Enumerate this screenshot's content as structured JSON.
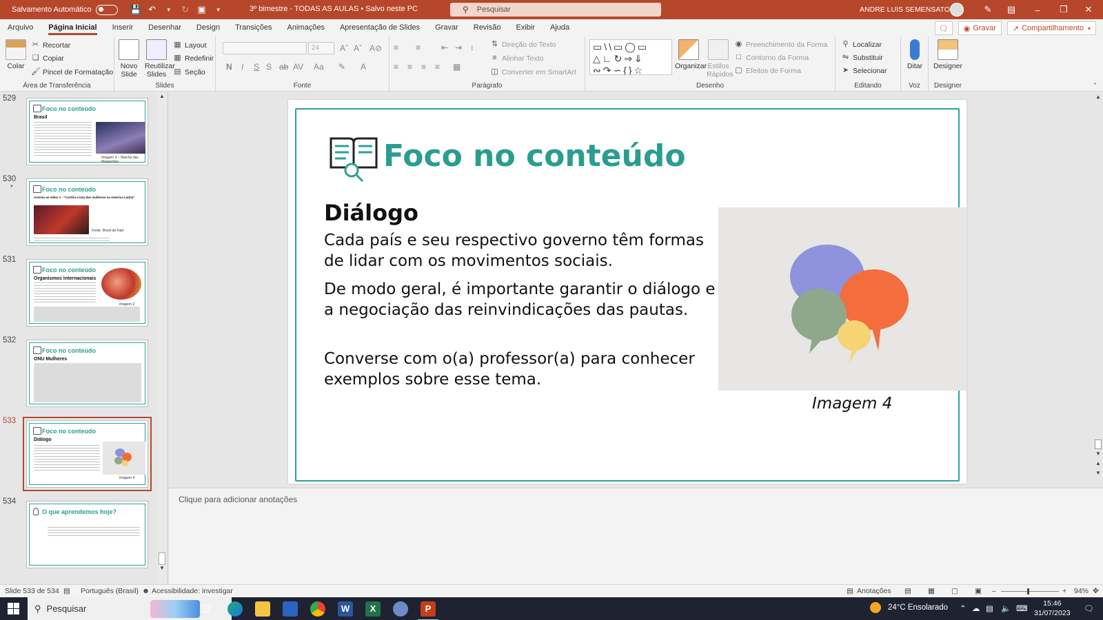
{
  "titlebar": {
    "autosave_label": "Salvamento Automático",
    "doc_title": "3º bimestre - TODAS AS AULAS • Salvo neste PC",
    "search_placeholder": "Pesquisar",
    "user_name": "ANDRE LUIS SEMENSATO",
    "accent": "#b7472a"
  },
  "menu": {
    "tabs": [
      "Arquivo",
      "Página Inicial",
      "Inserir",
      "Desenhar",
      "Design",
      "Transições",
      "Animações",
      "Apresentação de Slides",
      "Gravar",
      "Revisão",
      "Exibir",
      "Ajuda"
    ],
    "active_tab": "Página Inicial",
    "gravar_button": "Gravar",
    "share_button": "Compartilhamento"
  },
  "ribbon": {
    "clipboard": {
      "paste": "Colar",
      "cut": "Recortar",
      "copy": "Copiar",
      "format_painter": "Pincel de Formatação",
      "label": "Área de Transferência"
    },
    "slides": {
      "new_slide_1": "Novo",
      "new_slide_2": "Slide",
      "reuse_1": "Reutilizar",
      "reuse_2": "Slides",
      "layout": "Layout",
      "reset": "Redefinir",
      "section": "Seção",
      "label": "Slides"
    },
    "font": {
      "size": "24",
      "label": "Fonte"
    },
    "paragraph": {
      "text_direction": "Direção do Texto",
      "align_text": "Alinhar Texto",
      "smartart": "Converter em SmartArt",
      "label": "Parágrafo"
    },
    "drawing": {
      "arrange": "Organizar",
      "quick_styles_1": "Estilos",
      "quick_styles_2": "Rápidos",
      "shape_fill": "Preenchimento da Forma",
      "shape_outline": "Contorno da Forma",
      "shape_effects": "Efeitos de Forma",
      "label": "Desenho"
    },
    "editing": {
      "find": "Localizar",
      "replace": "Substituir",
      "select": "Selecionar",
      "label": "Editando"
    },
    "voice": {
      "dictate": "Ditar",
      "label": "Voz"
    },
    "designer": {
      "button": "Designer",
      "label": "Designer"
    }
  },
  "thumbnails": [
    {
      "number": "529",
      "title": "Foco no conteúdo",
      "heading": "Brasil",
      "caption": "Imagem 3 – Marcha das Margaridas"
    },
    {
      "number": "530",
      "star": "*",
      "title": "Foco no conteúdo",
      "heading": "Assista ao vídeo 1 - \"Confira a luta das mulheres na América Latina\"",
      "caption": "Fonte: Brasil de Fato"
    },
    {
      "number": "531",
      "title": "Foco no conteúdo",
      "heading": "Organismos internacionais",
      "caption": "Imagem 2"
    },
    {
      "number": "532",
      "title": "Foco no conteúdo",
      "heading": "ONU Mulheres",
      "caption": ""
    },
    {
      "number": "533",
      "title": "Foco no conteúdo",
      "heading": "Diálogo",
      "caption": "Imagem 4"
    },
    {
      "number": "534",
      "title": "O que aprendemos hoje?",
      "heading": "",
      "caption": ""
    }
  ],
  "slide": {
    "title": "Foco no conteúdo",
    "heading": "Diálogo",
    "paragraphs": [
      "Cada país e seu respectivo governo têm formas de lidar com os movimentos sociais.",
      "De modo geral, é importante garantir o diálogo e a negociação das reinvindicações das pautas.",
      "Converse com o(a) professor(a) para conhecer exemplos sobre esse tema."
    ],
    "image_caption": "Imagem 4",
    "title_color": "#2a9d8f"
  },
  "notes": {
    "placeholder": "Clique para adicionar anotações"
  },
  "status": {
    "slide_counter": "Slide 533 de 534",
    "language": "Português (Brasil)",
    "accessibility": "Acessibilidade: investigar",
    "notes_button": "Anotações",
    "zoom": "94%"
  },
  "taskbar": {
    "search_placeholder": "Pesquisar",
    "weather": "24°C  Ensolarado",
    "time": "15:46",
    "date": "31/07/2023"
  }
}
